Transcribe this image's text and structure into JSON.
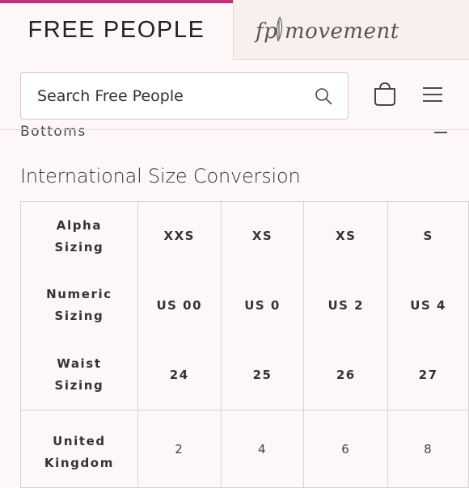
{
  "brand_tabs": {
    "primary": "FREE PEOPLE",
    "secondary": "fp movement"
  },
  "search": {
    "placeholder": "Search Free People"
  },
  "icons": [
    "search-icon",
    "bag-icon",
    "menu-icon",
    "collapse-icon"
  ],
  "section": {
    "label": "Bottoms"
  },
  "page_title": "International Size Conversion",
  "table": {
    "row_labels": [
      [
        "Alpha",
        "Sizing"
      ],
      [
        "Numeric",
        "Sizing"
      ],
      [
        "Waist",
        "Sizing"
      ],
      [
        "United",
        "Kingdom"
      ]
    ],
    "columns": [
      {
        "alpha": "XXS",
        "numeric": "US 00",
        "waist": "24",
        "uk": "2"
      },
      {
        "alpha": "XS",
        "numeric": "US 0",
        "waist": "25",
        "uk": "4"
      },
      {
        "alpha": "XS",
        "numeric": "US 2",
        "waist": "26",
        "uk": "6"
      },
      {
        "alpha": "S",
        "numeric": "US 4",
        "waist": "27",
        "uk": "8"
      }
    ]
  },
  "colors": {
    "accent": "#c2317a",
    "background": "#fdf8f7",
    "border": "#d8d3d3"
  }
}
